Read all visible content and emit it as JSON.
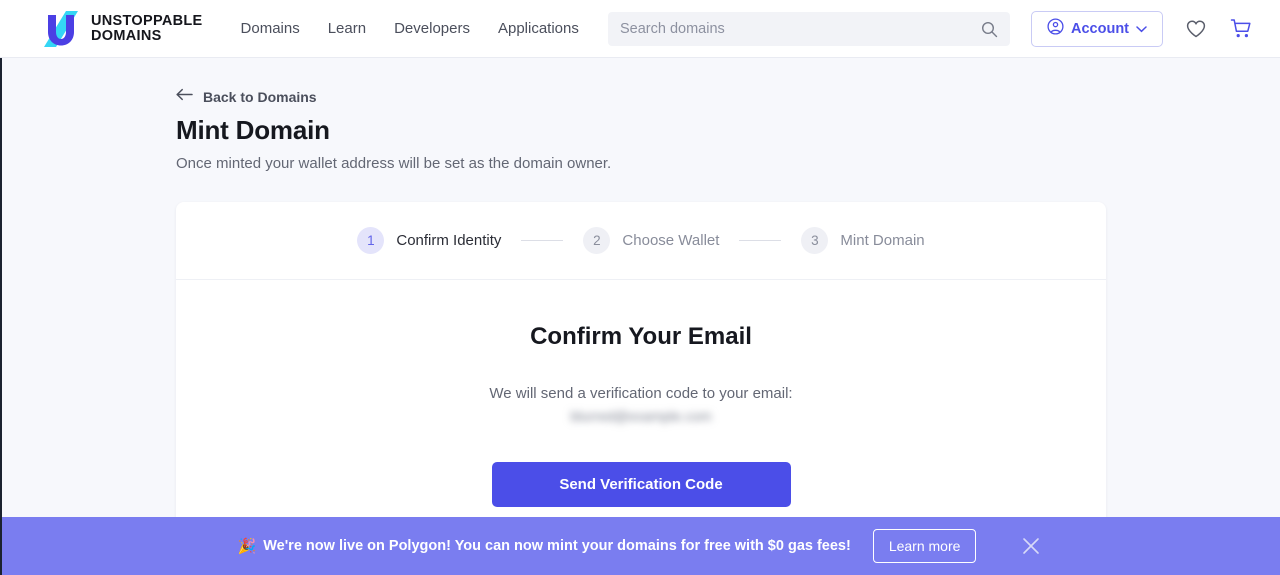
{
  "header": {
    "brand": {
      "line1": "UNSTOPPABLE",
      "line2": "DOMAINS",
      "logo_icon": "unstoppable-u-logo",
      "purple": "#4b3fe4",
      "cyan": "#34d6f5"
    },
    "nav": [
      {
        "label": "Domains"
      },
      {
        "label": "Learn"
      },
      {
        "label": "Developers"
      },
      {
        "label": "Applications"
      }
    ],
    "search": {
      "placeholder": "Search domains",
      "value": "",
      "icon": "search-icon"
    },
    "account": {
      "label": "Account",
      "user_icon": "user-circle-icon",
      "chevron_icon": "chevron-down-icon",
      "color": "#4b4ee8"
    },
    "wishlist_icon": "heart-icon",
    "cart_icon": "shopping-cart-icon"
  },
  "page": {
    "back_link": {
      "label": "Back to Domains",
      "icon": "arrow-left-icon"
    },
    "title": "Mint Domain",
    "subtitle": "Once minted your wallet address will be set as the domain owner."
  },
  "stepper": {
    "steps": [
      {
        "number": "1",
        "label": "Confirm Identity",
        "state": "active"
      },
      {
        "number": "2",
        "label": "Choose Wallet",
        "state": "inactive"
      },
      {
        "number": "3",
        "label": "Mint Domain",
        "state": "inactive"
      }
    ],
    "active_circle_bg": "#e4e4fb",
    "active_number_color": "#6264ea"
  },
  "main": {
    "heading": "Confirm Your Email",
    "description": "We will send a verification code to your email:",
    "email_masked": "blurred@example.com",
    "submit_label": "Send Verification Code",
    "submit_color": "#4b4ee8"
  },
  "banner": {
    "emoji": "🎉",
    "message": "We're now live on Polygon! You can now mint your domains for free with $0 gas fees!",
    "cta_label": "Learn more",
    "close_icon": "close-icon",
    "background": "#7a7df0"
  }
}
